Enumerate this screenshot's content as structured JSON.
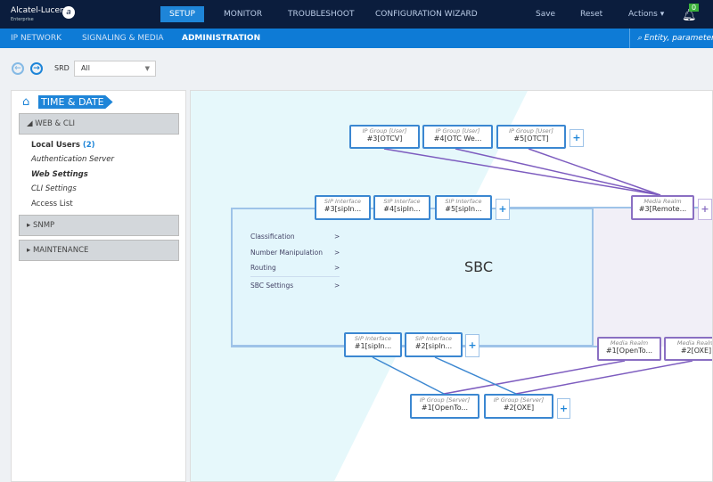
{
  "brand": {
    "name": "Alcatel-Lucent",
    "sub": "Enterprise"
  },
  "top_nav": [
    "SETUP",
    "MONITOR",
    "TROUBLESHOOT",
    "CONFIGURATION WIZARD"
  ],
  "top_actions": {
    "save": "Save",
    "reset": "Reset",
    "actions": "Actions ▾",
    "notifications": "0"
  },
  "sub_nav": [
    "IP NETWORK",
    "SIGNALING & MEDIA",
    "ADMINISTRATION"
  ],
  "search": {
    "placeholder": "Entity, parameter"
  },
  "srd": {
    "label": "SRD",
    "value": "All"
  },
  "sidebar": {
    "home": "TIME & DATE",
    "sections": [
      "WEB & CLI",
      "SNMP",
      "MAINTENANCE"
    ],
    "items": [
      {
        "label": "Local Users",
        "count": "(2)"
      },
      {
        "label": "Authentication Server"
      },
      {
        "label": "Web Settings"
      },
      {
        "label": "CLI Settings"
      },
      {
        "label": "Access List"
      }
    ]
  },
  "diagram": {
    "title": "SBC",
    "menu": [
      "Classification",
      "Number Manipulation",
      "Routing",
      "SBC Settings"
    ],
    "arrow": ">",
    "plus": "+",
    "ip_groups_user": {
      "type": "IP Group [User]",
      "items": [
        "#3[OTCV]",
        "#4[OTC We...",
        "#5[OTCT]"
      ]
    },
    "sip_if_top": {
      "type": "SIP Interface",
      "items": [
        "#3[sipIn...",
        "#4[sipIn...",
        "#5[sipIn..."
      ]
    },
    "media_realm_top": {
      "type": "Media Realm",
      "items": [
        "#3[Remote..."
      ]
    },
    "sip_if_bottom": {
      "type": "SIP Interface",
      "items": [
        "#1[sipIn...",
        "#2[sipIn..."
      ]
    },
    "media_realm_bottom": {
      "type": "Media Realm",
      "items": [
        "#1[OpenTo...",
        "#2[OXE]"
      ]
    },
    "ip_groups_server": {
      "type": "IP Group [Server]",
      "items": [
        "#1[OpenTo...",
        "#2[OXE]"
      ]
    }
  },
  "colors": {
    "accent": "#1e85d8",
    "topbar": "#0b1d3d",
    "media_realm": "#8a6fc2"
  }
}
